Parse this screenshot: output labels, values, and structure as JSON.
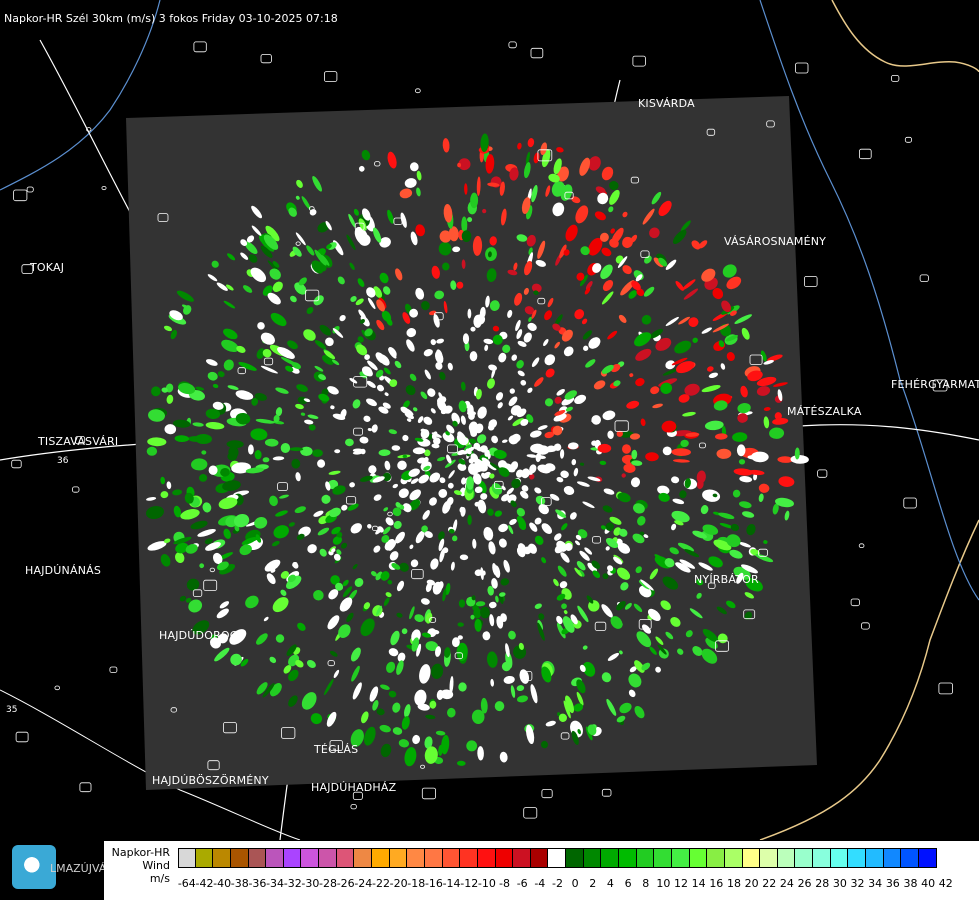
{
  "header": {
    "title": "Napkor-HR Szél 30km (m/s) 3 fokos Friday 03-10-2025 07:18"
  },
  "map": {
    "cities": [
      {
        "name": "KISVÁRDA"
      },
      {
        "name": "TOKAJ"
      },
      {
        "name": "VÁSÁROSNAMÉNY"
      },
      {
        "name": "FEHÉRGYARMAT"
      },
      {
        "name": "MÁTÉSZALKA"
      },
      {
        "name": "TISZAVASVÁRI"
      },
      {
        "name": "HAJDÚNÁNÁS"
      },
      {
        "name": "NYÍRBÁTOR"
      },
      {
        "name": "HAJDÚDOROG"
      },
      {
        "name": "TÉGLÁS"
      },
      {
        "name": "HAJDÚBÖSZÖRMÉNY"
      },
      {
        "name": "HAJDÚHADHÁZ"
      },
      {
        "name": "LMAZÚJVÁR"
      }
    ],
    "road_numbers": [
      "36",
      "35"
    ],
    "colors": {
      "background": "#000000",
      "radar_area": "#333333",
      "borders": "#ffffff",
      "rivers": "#5b8fd0",
      "county_line": "#e8c98a"
    }
  },
  "logo": {
    "icon": "napkor-logo-icon"
  },
  "legend": {
    "title_lines": [
      "Napkor-HR",
      "Wind",
      "m/s"
    ],
    "colors": [
      "#d8d8d8",
      "#aaaa00",
      "#bb8800",
      "#aa5500",
      "#aa5555",
      "#bb55bb",
      "#aa44ff",
      "#cc55dd",
      "#cc55aa",
      "#dd5577",
      "#ee8844",
      "#ffaa00",
      "#ffaa22",
      "#ff8844",
      "#ff7744",
      "#ff5533",
      "#ff3322",
      "#ff1111",
      "#ee0000",
      "#cc1122",
      "#aa0000",
      "#ffffff",
      "#006600",
      "#008800",
      "#00aa00",
      "#00bb00",
      "#22cc22",
      "#33dd33",
      "#44ee44",
      "#66ff33",
      "#88ee44",
      "#aaff66",
      "#ffff88",
      "#ddffaa",
      "#bbffbb",
      "#99ffcc",
      "#88ffdd",
      "#66ffee",
      "#33ddff",
      "#22bbff",
      "#1188ff",
      "#0055ff",
      "#0011ff"
    ],
    "tick_labels": [
      "-64",
      "-42",
      "-40",
      "-38",
      "-36",
      "-34",
      "-32",
      "-30",
      "-28",
      "-26",
      "-24",
      "-22",
      "-20",
      "-18",
      "-16",
      "-14",
      "-12",
      "-10",
      "-8",
      "-6",
      "-4",
      "-2",
      "0",
      "2",
      "4",
      "6",
      "8",
      "10",
      "12",
      "14",
      "16",
      "18",
      "20",
      "22",
      "24",
      "26",
      "28",
      "30",
      "32",
      "34",
      "36",
      "38",
      "40",
      "42"
    ]
  }
}
